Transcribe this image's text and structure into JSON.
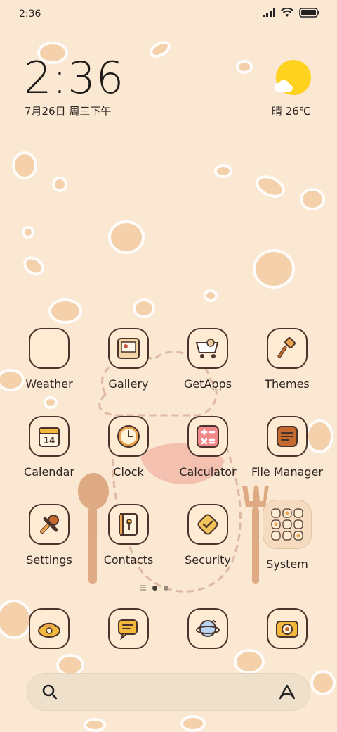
{
  "status_bar": {
    "time": "2:36",
    "battery": "full"
  },
  "clock_widget": {
    "time": "2:36",
    "date": "7月26日 周三下午"
  },
  "weather_widget": {
    "condition": "晴",
    "temperature": "晴 26℃",
    "icon": "sun-cloud-icon"
  },
  "apps": [
    {
      "label": "Weather",
      "icon": "weather-icon"
    },
    {
      "label": "Gallery",
      "icon": "gallery-icon"
    },
    {
      "label": "GetApps",
      "icon": "getapps-icon"
    },
    {
      "label": "Themes",
      "icon": "themes-icon"
    },
    {
      "label": "Calendar",
      "icon": "calendar-icon",
      "day": "14"
    },
    {
      "label": "Clock",
      "icon": "clock-icon"
    },
    {
      "label": "Calculator",
      "icon": "calculator-icon"
    },
    {
      "label": "File Manager",
      "icon": "file-manager-icon"
    },
    {
      "label": "Settings",
      "icon": "settings-icon"
    },
    {
      "label": "Contacts",
      "icon": "contacts-icon"
    },
    {
      "label": "Security",
      "icon": "security-icon"
    },
    {
      "label": "System",
      "icon": "system-folder-icon"
    }
  ],
  "page_indicator": {
    "pages": 2,
    "current": 1
  },
  "dock": [
    {
      "icon": "phone-icon"
    },
    {
      "icon": "messages-icon"
    },
    {
      "icon": "browser-icon"
    },
    {
      "icon": "camera-icon"
    }
  ],
  "search": {
    "icon": "search-icon",
    "assistant_icon": "assistant-icon"
  },
  "colors": {
    "background": "#fbe8d3",
    "icon_outline": "#4a332a",
    "accent_orange": "#e9a24e",
    "sun": "#ffd21f"
  }
}
